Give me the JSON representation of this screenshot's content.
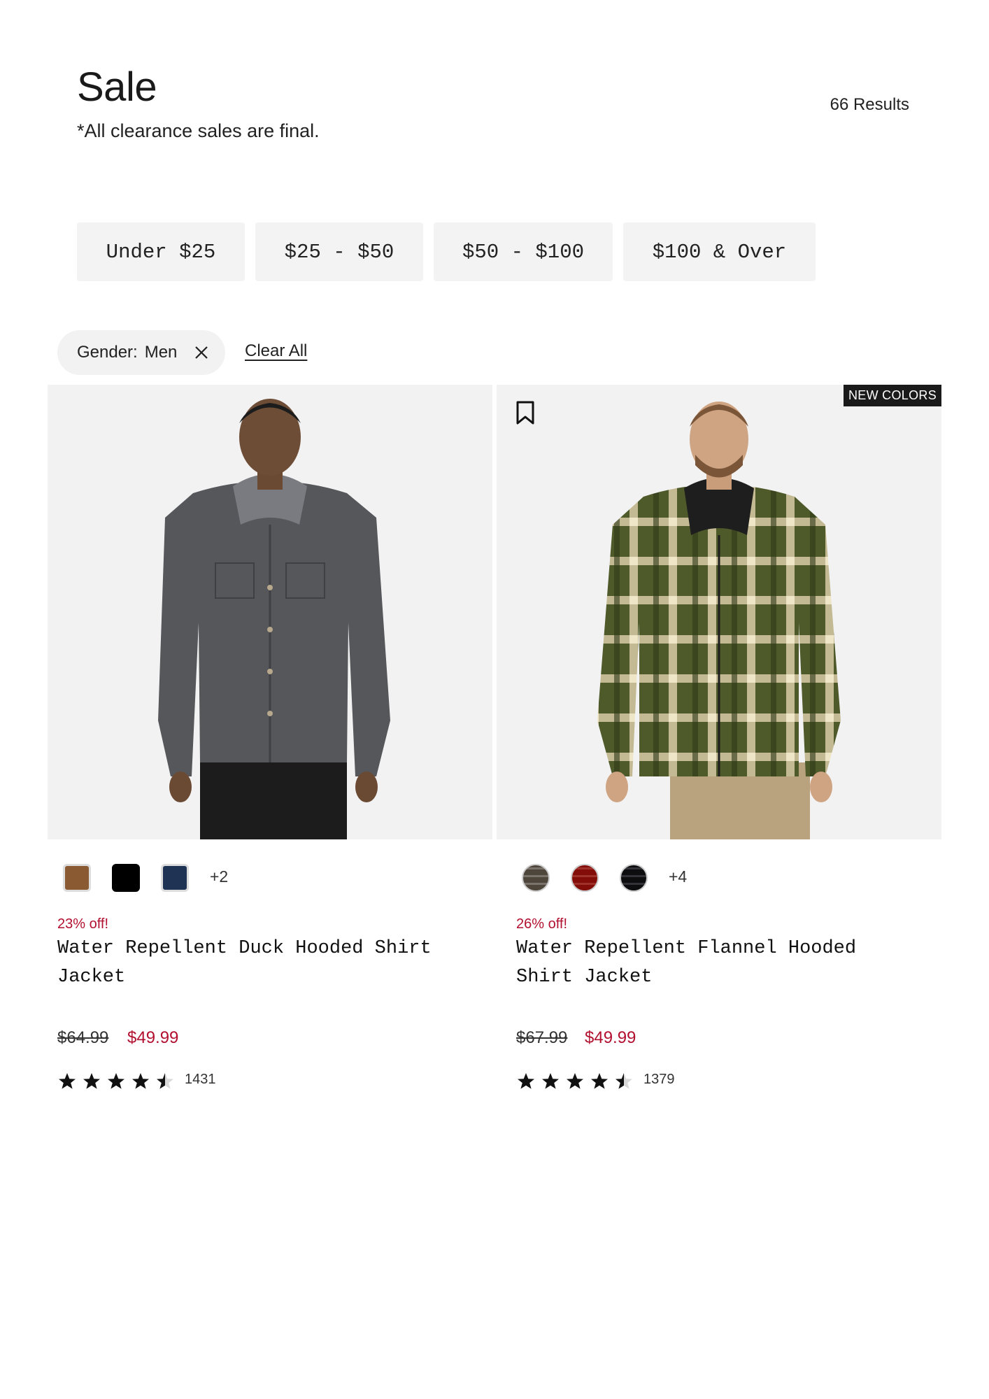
{
  "header": {
    "title": "Sale",
    "subtitle": "*All clearance sales are final.",
    "results": "66 Results"
  },
  "price_filters": [
    "Under $25",
    "$25 - $50",
    "$50 - $100",
    "$100 & Over"
  ],
  "active_filter": {
    "label": "Gender:",
    "value": "Men",
    "clear_all": "Clear All"
  },
  "products": [
    {
      "badge": "",
      "swatches": [
        "#8a5a32",
        "#000000",
        "#1f3354"
      ],
      "more_colors": "+2",
      "discount": "23% off!",
      "name": "Water Repellent Duck Hooded Shirt Jacket",
      "original_price": "$64.99",
      "sale_price": "$49.99",
      "rating": 4.5,
      "review_count": "1431",
      "jacket_color": "#55575b"
    },
    {
      "badge": "NEW COLORS",
      "swatches": [
        "#8d857b",
        "#b73a30",
        "#3a3a40"
      ],
      "more_colors": "+4",
      "discount": "26% off!",
      "name": "Water Repellent Flannel Hooded Shirt Jacket",
      "original_price": "$67.99",
      "sale_price": "$49.99",
      "rating": 4.5,
      "review_count": "1379",
      "jacket_color": "#4e5a2a"
    }
  ],
  "colors": {
    "sale_red": "#b2102f",
    "button_bg": "#f3f3f3",
    "badge_bg": "#1a1a1a"
  }
}
